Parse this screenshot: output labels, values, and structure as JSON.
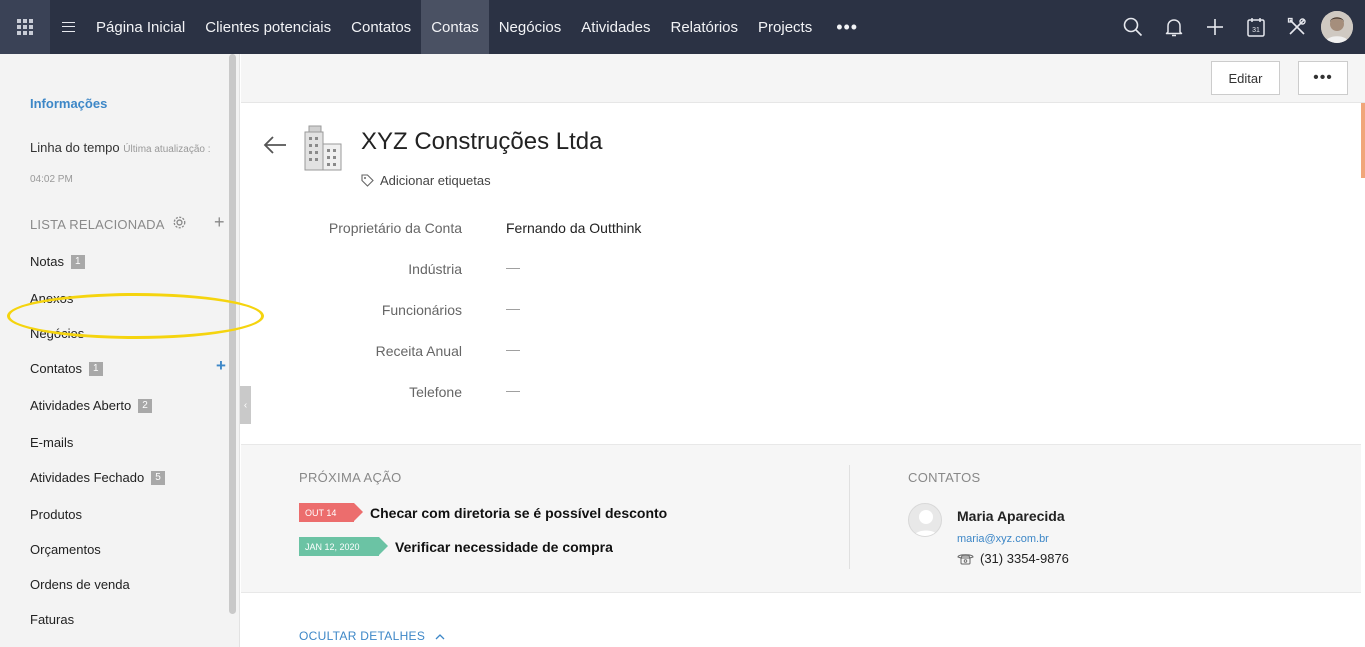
{
  "topnav": {
    "menu_items": [
      "Página Inicial",
      "Clientes potenciais",
      "Contatos",
      "Contas",
      "Negócios",
      "Atividades",
      "Relatórios",
      "Projects"
    ],
    "active_item": "Contas",
    "more_label": "•••",
    "calendar_day": "31",
    "icons": [
      "app-grid-icon",
      "hamburger-icon",
      "search-icon",
      "bell-icon",
      "plus-icon",
      "calendar-icon",
      "tools-icon",
      "user-avatar"
    ]
  },
  "sidebar": {
    "info_label": "Informações",
    "timeline_label": "Linha do tempo",
    "timeline_updated_label": "Última atualização :",
    "timeline_time": "04:02 PM",
    "related_list_title": "LISTA RELACIONADA",
    "items": [
      {
        "label": "Notas",
        "count": "1"
      },
      {
        "label": "Anexos",
        "count": ""
      },
      {
        "label": "Negócios",
        "count": ""
      },
      {
        "label": "Contatos",
        "count": "1"
      },
      {
        "label": "Atividades Aberto",
        "count": "2"
      },
      {
        "label": "E-mails",
        "count": ""
      },
      {
        "label": "Atividades Fechado",
        "count": "5"
      },
      {
        "label": "Produtos",
        "count": ""
      },
      {
        "label": "Orçamentos",
        "count": ""
      },
      {
        "label": "Ordens de venda",
        "count": ""
      },
      {
        "label": "Faturas",
        "count": ""
      }
    ],
    "highlight_color": "#f5d40e"
  },
  "toolbar": {
    "edit_label": "Editar",
    "more_label": "•••"
  },
  "account": {
    "name": "XYZ Construções Ltda",
    "add_tags_label": "Adicionar etiquetas",
    "fields": [
      {
        "label": "Proprietário da Conta",
        "value": "Fernando da Outthink"
      },
      {
        "label": "Indústria",
        "value": "—"
      },
      {
        "label": "Funcionários",
        "value": "—"
      },
      {
        "label": "Receita Anual",
        "value": "—"
      },
      {
        "label": "Telefone",
        "value": "—"
      }
    ]
  },
  "next_action": {
    "title": "PRÓXIMA AÇÃO",
    "tasks": [
      {
        "date": "OUT 14",
        "text": "Checar com diretoria se é possível desconto",
        "color": "#ec6d6d"
      },
      {
        "date": "JAN 12, 2020",
        "text": "Verificar necessidade de compra",
        "color": "#6bc3a4"
      }
    ]
  },
  "contacts": {
    "title": "CONTATOS",
    "name": "Maria Aparecida",
    "email": "maria@xyz.com.br",
    "phone": "(31) 3354-9876"
  },
  "hide_details_label": "OCULTAR DETALHES",
  "colors": {
    "topbar": "#2b3244",
    "accent_blue": "#3d87c7",
    "active_tab": "#4a5163"
  }
}
